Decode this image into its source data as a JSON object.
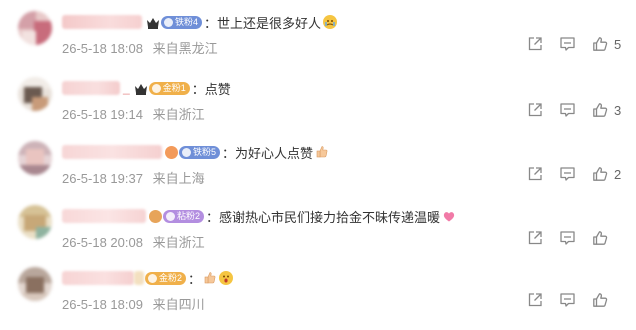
{
  "comments": [
    {
      "badge": "铁粉4",
      "badge_color": "#6f8fd8",
      "text": "：世上还是很多好人",
      "time": "26-5-18 18:08",
      "location": "来自黑龙江",
      "likes": "5",
      "emoji": "crying-face-emoji"
    },
    {
      "name_tail": "_",
      "badge": "金粉1",
      "badge_color": "#f0b04a",
      "text": "：点赞",
      "time": "26-5-18 19:14",
      "location": "来自浙江",
      "likes": "3"
    },
    {
      "badge": "铁粉5",
      "badge_color": "#6f8fd8",
      "text": "：为好心人点赞",
      "time": "26-5-18 19:37",
      "location": "来自上海",
      "likes": "2",
      "emoji": "thumbs-up-emoji"
    },
    {
      "badge": "粘粉2",
      "badge_color": "#b38ee0",
      "text": "：感谢热心市民们接力拾金不昧传递温暖",
      "time": "26-5-18 20:08",
      "location": "来自浙江",
      "likes": "",
      "emoji": "heart-emoji"
    },
    {
      "badge": "金粉2",
      "badge_color": "#f0b04a",
      "text": "：",
      "time": "26-5-18 18:09",
      "location": "来自四川",
      "likes": "",
      "emoji": "thumbs-up-emoji"
    }
  ],
  "icons": {
    "share": "share-icon",
    "comment": "comment-icon",
    "like": "like-icon",
    "crown": "crown-icon"
  },
  "colors": {
    "meta_text": "#999999",
    "body_text": "#333333",
    "icon": "#888888"
  }
}
